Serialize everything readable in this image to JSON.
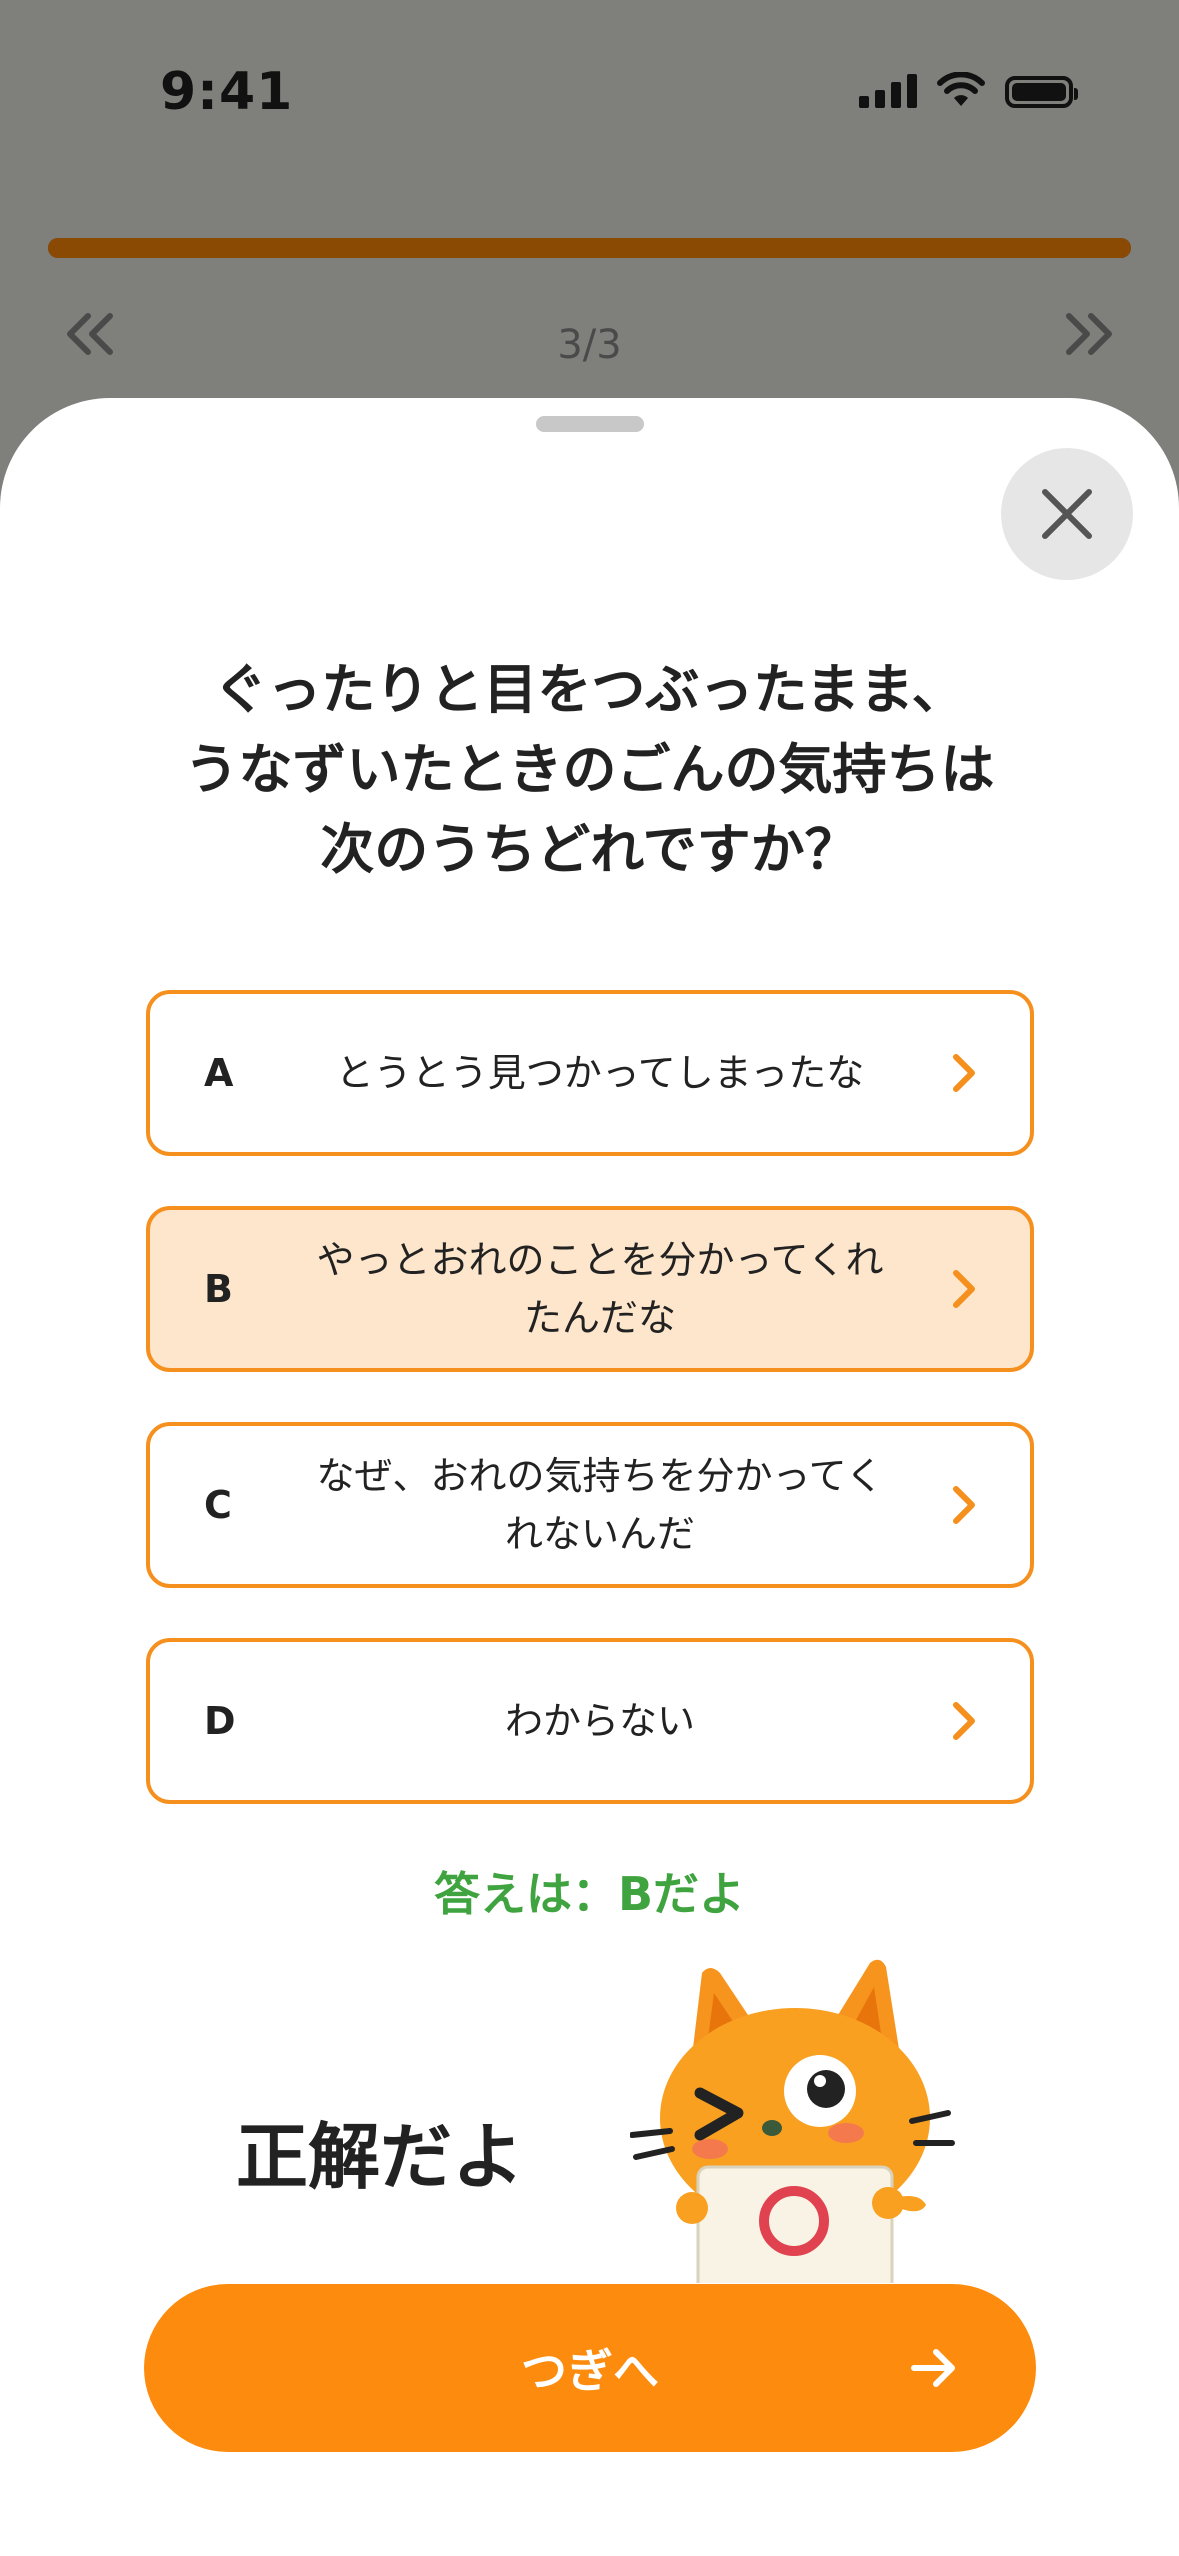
{
  "status_bar": {
    "time": "9:41"
  },
  "quiz": {
    "progress": 1.0,
    "counter": "3/3",
    "prev_icon": "double-chevron-left-icon",
    "next_icon": "double-chevron-right-icon"
  },
  "sheet": {
    "close_icon": "close-icon",
    "question": "ぐったりと目をつぶったまま、\nうなずいたときのごんの気持ちは\n次のうちどれですか？",
    "options": [
      {
        "letter": "A",
        "text": "とうとう見つかってしまったな",
        "selected": false
      },
      {
        "letter": "B",
        "text": "やっとおれのことを分かってくれ\nたんだな",
        "selected": true
      },
      {
        "letter": "C",
        "text": "なぜ、おれの気持ちを分かってく\nれないんだ",
        "selected": false
      },
      {
        "letter": "D",
        "text": "わからない",
        "selected": false
      }
    ],
    "answer": "答えは：Bだよ",
    "result": "正解だよ",
    "next_button": "つぎへ"
  },
  "colors": {
    "accent": "#fd8c0e",
    "option_border": "#f5901e",
    "selected_bg": "#fde6cb",
    "correct_text": "#3fa33f",
    "progress": "#8b4a04"
  }
}
